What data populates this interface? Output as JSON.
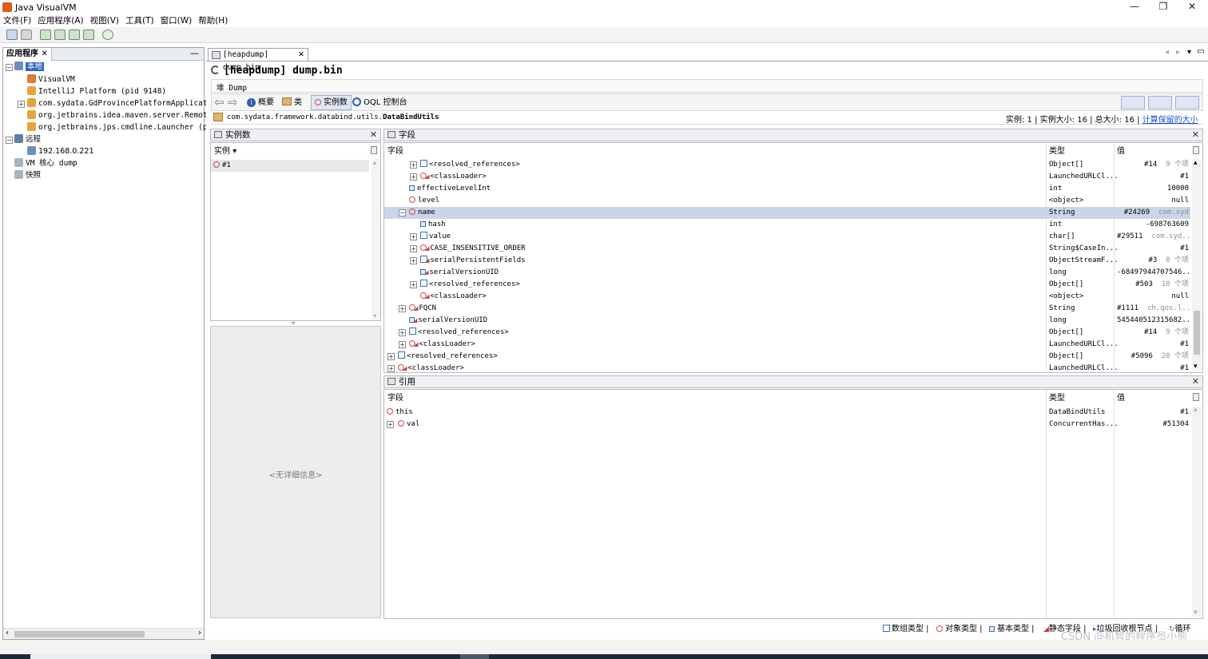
{
  "window": {
    "title": "Java VisualVM"
  },
  "menu": [
    "文件(F)",
    "应用程序(A)",
    "视图(V)",
    "工具(T)",
    "窗口(W)",
    "帮助(H)"
  ],
  "left_panel": {
    "tab_label": "应用程序",
    "tree": [
      {
        "label": "本地",
        "level": 0,
        "selected": true
      },
      {
        "label": "VisualVM",
        "level": 1
      },
      {
        "label": "IntelliJ Platform (pid 9148)",
        "level": 1
      },
      {
        "label": "com.sydata.GdProvincePlatformApplication (pi",
        "level": 1
      },
      {
        "label": "org.jetbrains.idea.maven.server.RemoteMavenS",
        "level": 1
      },
      {
        "label": "org.jetbrains.jps.cmdline.Launcher (pid 1493",
        "level": 1
      },
      {
        "label": "远程",
        "level": 0
      },
      {
        "label": "192.168.0.221",
        "level": 1
      },
      {
        "label": "VM 核心 dump",
        "level": 0
      },
      {
        "label": "快照",
        "level": 0
      }
    ]
  },
  "main": {
    "tab_label": "[heapdump] dump.bin",
    "header_title": "[heapdump] dump.bin",
    "sub_label": "堆 Dump",
    "nav": {
      "summary": "概要",
      "classes": "类",
      "instances": "实例数",
      "oql": "OQL 控制台"
    },
    "class_path_prefix": "com.sydata.framework.databind.utils.",
    "class_name": "DataBindUtils",
    "stats": {
      "instances": "实例: 1",
      "instance_size": "实例大小: 16",
      "total_size": "总大小: 16",
      "retained_link": "计算保留的大小"
    }
  },
  "instances_panel": {
    "title": "实例数",
    "column": "实例",
    "items": [
      "#1"
    ],
    "no_detail": "<无详细信息>"
  },
  "fields_panel": {
    "title": "字段",
    "columns": {
      "field": "字段",
      "type": "类型",
      "value": "值"
    },
    "rows": [
      {
        "indent": 2,
        "expand": "+",
        "icon": "array",
        "name": "<resolved_references>",
        "type": "Object[]",
        "value": "#14",
        "extra": "9 个项"
      },
      {
        "indent": 2,
        "expand": "+",
        "icon": "object-static",
        "name": "<classLoader>",
        "type": "LaunchedURLCl...",
        "value": "#1",
        "extra": ""
      },
      {
        "indent": 1,
        "expand": "",
        "icon": "primitive",
        "name": "effectiveLevelInt",
        "type": "int",
        "value": "10000",
        "extra": ""
      },
      {
        "indent": 1,
        "expand": "",
        "icon": "object",
        "name": "level",
        "type": "<object>",
        "value": "null",
        "extra": ""
      },
      {
        "indent": 1,
        "expand": "-",
        "icon": "object",
        "name": "name",
        "type": "String",
        "value": "#24269",
        "extra": "com.syd",
        "selected": true
      },
      {
        "indent": 2,
        "expand": "",
        "icon": "primitive",
        "name": "hash",
        "type": "int",
        "value": "-698763609",
        "extra": ""
      },
      {
        "indent": 2,
        "expand": "+",
        "icon": "array",
        "name": "value",
        "type": "char[]",
        "value": "#29511",
        "extra": "com.syd..."
      },
      {
        "indent": 2,
        "expand": "+",
        "icon": "object-static",
        "name": "CASE_INSENSITIVE_ORDER",
        "type": "String$CaseIn...",
        "value": "#1",
        "extra": ""
      },
      {
        "indent": 2,
        "expand": "+",
        "icon": "array-static",
        "name": "serialPersistentFields",
        "type": "ObjectStreamF...",
        "value": "#3",
        "extra": "0 个项"
      },
      {
        "indent": 2,
        "expand": "",
        "icon": "primitive-static",
        "name": "serialVersionUID",
        "type": "long",
        "value": "-68497944707546...",
        "extra": ""
      },
      {
        "indent": 2,
        "expand": "+",
        "icon": "array",
        "name": "<resolved_references>",
        "type": "Object[]",
        "value": "#503",
        "extra": "10 个项"
      },
      {
        "indent": 2,
        "expand": "",
        "icon": "object-static",
        "name": "<classLoader>",
        "type": "<object>",
        "value": "null",
        "extra": ""
      },
      {
        "indent": 1,
        "expand": "+",
        "icon": "object-static",
        "name": "FQCN",
        "type": "String",
        "value": "#1111",
        "extra": "ch.qos.l..."
      },
      {
        "indent": 1,
        "expand": "",
        "icon": "primitive-static",
        "name": "serialVersionUID",
        "type": "long",
        "value": "545440512315682...",
        "extra": ""
      },
      {
        "indent": 1,
        "expand": "+",
        "icon": "array",
        "name": "<resolved_references>",
        "type": "Object[]",
        "value": "#14",
        "extra": "9 个项"
      },
      {
        "indent": 1,
        "expand": "+",
        "icon": "object-static",
        "name": "<classLoader>",
        "type": "LaunchedURLCl...",
        "value": "#1",
        "extra": ""
      },
      {
        "indent": 0,
        "expand": "+",
        "icon": "array",
        "name": "<resolved_references>",
        "type": "Object[]",
        "value": "#5096",
        "extra": "20 个项"
      },
      {
        "indent": 0,
        "expand": "+",
        "icon": "object-static",
        "name": "<classLoader>",
        "type": "LaunchedURLCl...",
        "value": "#1",
        "extra": ""
      }
    ]
  },
  "references_panel": {
    "title": "引用",
    "columns": {
      "field": "字段",
      "type": "类型",
      "value": "值"
    },
    "rows": [
      {
        "expand": "",
        "name": "this",
        "type": "DataBindUtils",
        "value": "#1"
      },
      {
        "expand": "+",
        "name": "val",
        "type": "ConcurrentHas...",
        "value": "#51304"
      }
    ]
  },
  "legend": {
    "array": "数组类型",
    "object": "对象类型",
    "primitive": "基本类型",
    "static": "静态字段",
    "gc_root": "垃圾回收根节点",
    "loop": "循环"
  },
  "watermark": "CSDN @机智的程序员小熊"
}
